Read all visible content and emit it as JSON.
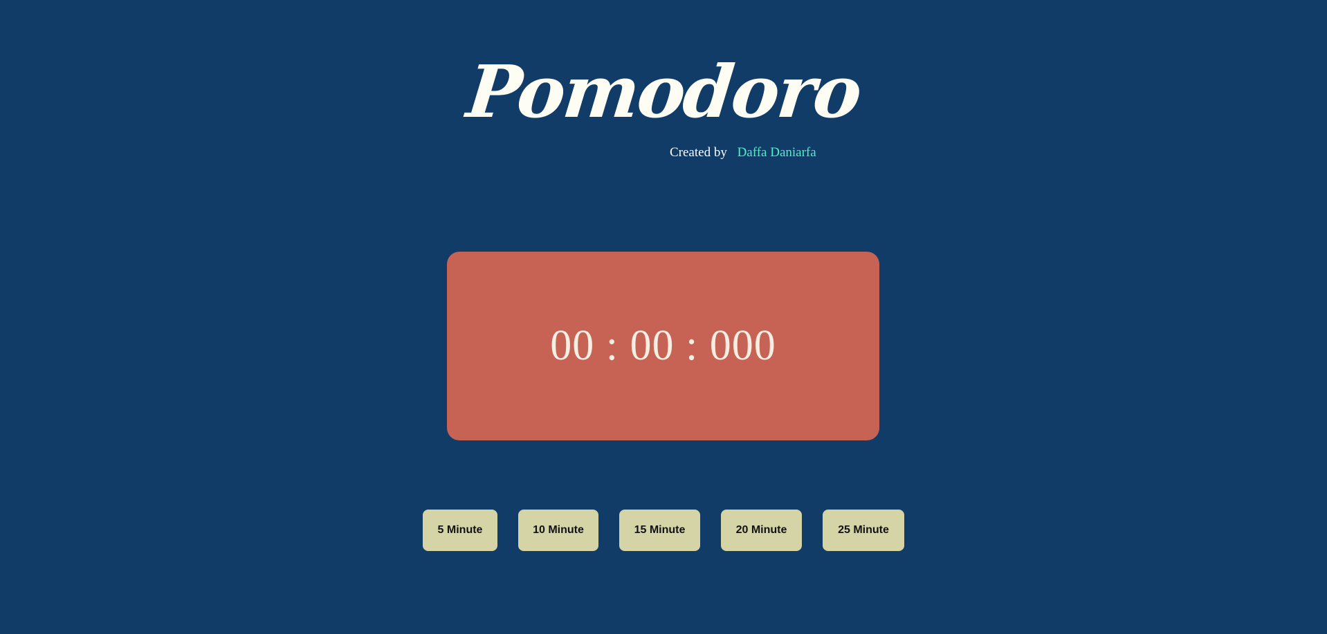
{
  "header": {
    "title": "Pomodoro",
    "credit_prefix": "Created by",
    "author": "Daffa Daniarfa"
  },
  "timer": {
    "display": "00 : 00 : 000"
  },
  "presets": [
    {
      "label": "5 Minute"
    },
    {
      "label": "10 Minute"
    },
    {
      "label": "15 Minute"
    },
    {
      "label": "20 Minute"
    },
    {
      "label": "25 Minute"
    }
  ],
  "colors": {
    "background": "#103c67",
    "timer_box": "#c66354",
    "button": "#d5d4a6",
    "author_link": "#4ff0c6"
  }
}
